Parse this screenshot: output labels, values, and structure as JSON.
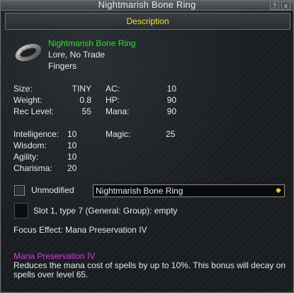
{
  "window": {
    "title": "Nightmarish Bone Ring",
    "help_label": "?",
    "close_label": "x"
  },
  "tab": {
    "label": "Description"
  },
  "item": {
    "name": "Nightmarish Bone Ring",
    "flags": "Lore, No Trade",
    "slot_type": "Fingers",
    "icon": "ring-icon"
  },
  "stats": {
    "size": {
      "label": "Size:",
      "value": "TINY"
    },
    "weight": {
      "label": "Weight:",
      "value": "0.8"
    },
    "rec_level": {
      "label": "Rec Level:",
      "value": "55"
    },
    "ac": {
      "label": "AC:",
      "value": "10"
    },
    "hp": {
      "label": "HP:",
      "value": "90"
    },
    "mana": {
      "label": "Mana:",
      "value": "90"
    },
    "intelligence": {
      "label": "Intelligence:",
      "value": "10"
    },
    "wisdom": {
      "label": "Wisdom:",
      "value": "10"
    },
    "agility": {
      "label": "Agility:",
      "value": "10"
    },
    "charisma": {
      "label": "Charisma:",
      "value": "20"
    },
    "magic": {
      "label": "Magic:",
      "value": "25"
    }
  },
  "modify": {
    "checkbox_label": "Unmodified",
    "checked": false,
    "selected": "Nightmarish Bone Ring"
  },
  "augment_slot": {
    "text": "Slot 1, type 7 (General: Group): empty"
  },
  "focus": {
    "text": "Focus Effect: Mana Preservation IV",
    "spell_name": "Mana Preservation IV",
    "description": "Reduces the mana cost of spells by up to 10%. This bonus will decay on spells over level 65."
  },
  "colors": {
    "item_name": "#2dde2d",
    "tab_label": "#f0e130",
    "spell_name": "#d23be0"
  }
}
